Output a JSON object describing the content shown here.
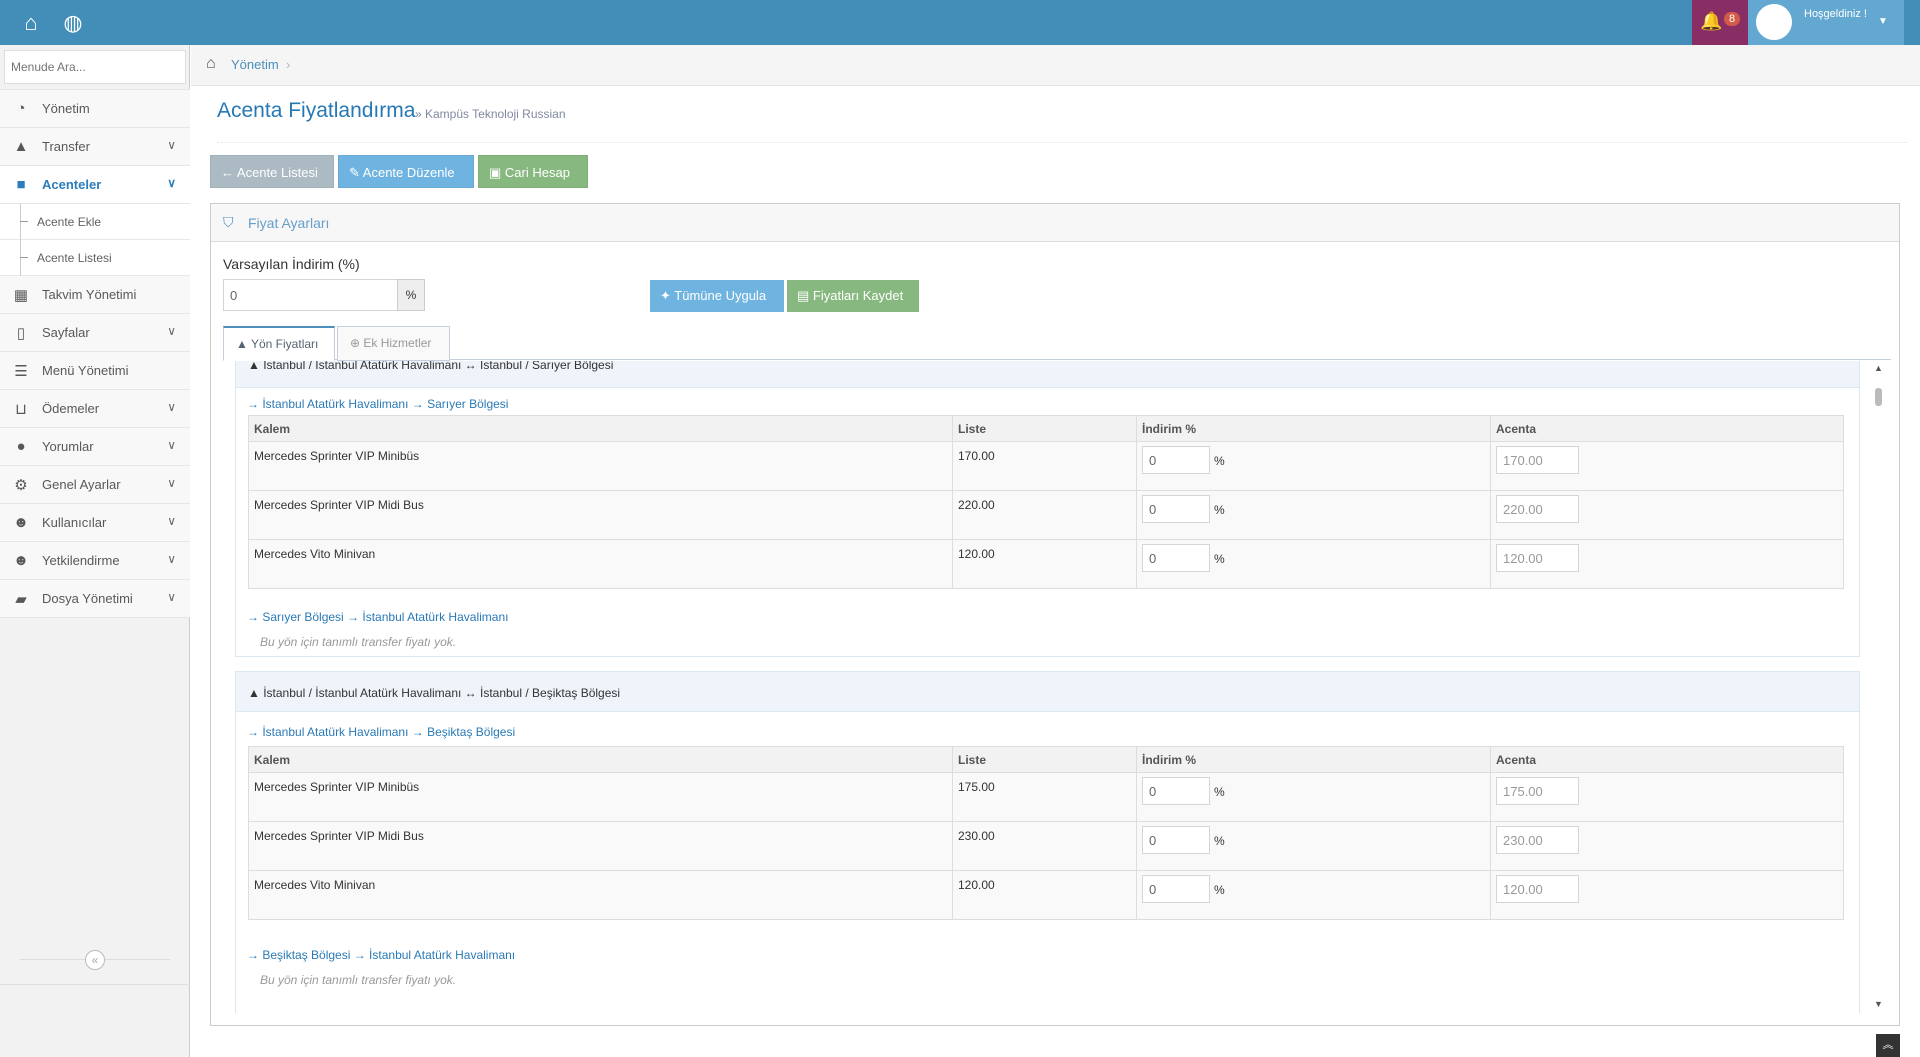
{
  "topbar": {
    "notif_count": "8",
    "welcome": "Hoşgeldiniz !"
  },
  "sidebar": {
    "search_placeholder": "Menude Ara...",
    "items": [
      {
        "label": "Yönetim",
        "icon": "dashboard-icon"
      },
      {
        "label": "Transfer",
        "icon": "road-icon"
      },
      {
        "label": "Acenteler",
        "icon": "briefcase-icon"
      },
      {
        "label": "Acente Ekle"
      },
      {
        "label": "Acente Listesi"
      },
      {
        "label": "Takvim Yönetimi",
        "icon": "calendar-icon"
      },
      {
        "label": "Sayfalar",
        "icon": "file-icon"
      },
      {
        "label": "Menü Yönetimi",
        "icon": "list-icon"
      },
      {
        "label": "Ödemeler",
        "icon": "cart-icon"
      },
      {
        "label": "Yorumlar",
        "icon": "comments-icon"
      },
      {
        "label": "Genel Ayarlar",
        "icon": "cogs-icon"
      },
      {
        "label": "Kullanıcılar",
        "icon": "users-icon"
      },
      {
        "label": "Yetkilendirme",
        "icon": "users-icon"
      },
      {
        "label": "Dosya Yönetimi",
        "icon": "folder-icon"
      }
    ]
  },
  "breadcrumb": {
    "item": "Yönetim"
  },
  "page": {
    "title": "Acenta Fiyatlandırma",
    "subtitle": "» Kampüs Teknoloji Russian"
  },
  "toolbar": {
    "list": "Acente Listesi",
    "edit": "Acente Düzenle",
    "account": "Cari Hesap"
  },
  "panel": {
    "title": "Fiyat Ayarları",
    "default_discount_label": "Varsayılan İndirim (%)",
    "default_discount_value": "0",
    "pct": "%",
    "apply_all": "Tümüne Uygula",
    "save_prices": "Fiyatları Kaydet"
  },
  "tabs": {
    "route_prices": "Yön Fiyatları",
    "extras": "Ek Hizmetler"
  },
  "groups": [
    {
      "header": "İstanbul / İstanbul Atatürk Havalimanı ↔ İstanbul / Sarıyer Bölgesi",
      "dir1": "İstanbul Atatürk Havalimanı → Sarıyer Bölgesi",
      "dir2": "Sarıyer Bölgesi → İstanbul Atatürk Havalimanı",
      "empty": "Bu yön için tanımlı transfer fiyatı yok.",
      "rows": [
        {
          "item": "Mercedes Sprinter VIP Minibüs",
          "list": "170.00",
          "disc": "0",
          "agency": "170.00"
        },
        {
          "item": "Mercedes Sprinter VIP Midi Bus",
          "list": "220.00",
          "disc": "0",
          "agency": "220.00"
        },
        {
          "item": "Mercedes Vito Minivan",
          "list": "120.00",
          "disc": "0",
          "agency": "120.00"
        }
      ]
    },
    {
      "header": "İstanbul / İstanbul Atatürk Havalimanı ↔ İstanbul / Beşiktaş Bölgesi",
      "dir1": "İstanbul Atatürk Havalimanı → Beşiktaş Bölgesi",
      "dir2": "Beşiktaş Bölgesi → İstanbul Atatürk Havalimanı",
      "empty": "Bu yön için tanımlı transfer fiyatı yok.",
      "rows": [
        {
          "item": "Mercedes Sprinter VIP Minibüs",
          "list": "175.00",
          "disc": "0",
          "agency": "175.00"
        },
        {
          "item": "Mercedes Sprinter VIP Midi Bus",
          "list": "230.00",
          "disc": "0",
          "agency": "230.00"
        },
        {
          "item": "Mercedes Vito Minivan",
          "list": "120.00",
          "disc": "0",
          "agency": "120.00"
        }
      ]
    }
  ],
  "table_headers": {
    "item": "Kalem",
    "list": "Liste",
    "disc": "İndirim %",
    "agency": "Acenta"
  }
}
